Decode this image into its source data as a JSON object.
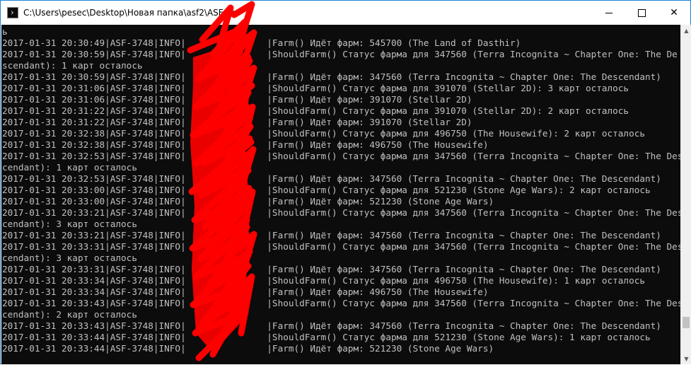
{
  "window": {
    "title": "C:\\Users\\pesec\\Desktop\\Новая папка\\asf2\\ASF.exe",
    "icon_text": "›"
  },
  "controls": {
    "minimize": "minimize-icon",
    "maximize": "maximize-icon",
    "close_glyph": "✕"
  },
  "console": {
    "lines": [
      "ь",
      "2017-01-31 20:30:49|ASF-3748|INFO|               |Farm() Идёт фарм: 545700 (The Land of Dasthir)",
      "2017-01-31 20:30:59|ASF-3748|INFO|               |ShouldFarm() Статус фарма для 347560 (Terra Incognita ~ Chapter One: The De",
      "scendant): 1 карт осталось",
      "2017-01-31 20:30:59|ASF-3748|INFO|               |Farm() Идёт фарм: 347560 (Terra Incognita ~ Chapter One: The Descendant)",
      "2017-01-31 20:31:06|ASF-3748|INFO|               |ShouldFarm() Статус фарма для 391070 (Stellar 2D): 3 карт осталось",
      "2017-01-31 20:31:06|ASF-3748|INFO|               |Farm() Идёт фарм: 391070 (Stellar 2D)",
      "2017-01-31 20:31:22|ASF-3748|INFO|               |ShouldFarm() Статус фарма для 391070 (Stellar 2D): 2 карт осталось",
      "2017-01-31 20:31:22|ASF-3748|INFO|               |Farm() Идёт фарм: 391070 (Stellar 2D)",
      "2017-01-31 20:32:38|ASF-3748|INFO|               |ShouldFarm() Статус фарма для 496750 (The Housewife): 2 карт осталось",
      "2017-01-31 20:32:38|ASF-3748|INFO|               |Farm() Идёт фарм: 496750 (The Housewife)",
      "2017-01-31 20:32:53|ASF-3748|INFO|               |ShouldFarm() Статус фарма для 347560 (Terra Incognita ~ Chapter One: The Desc",
      "cendant): 1 карт осталось",
      "2017-01-31 20:32:53|ASF-3748|INFO|               |Farm() Идёт фарм: 347560 (Terra Incognita ~ Chapter One: The Descendant)",
      "2017-01-31 20:33:00|ASF-3748|INFO|               |ShouldFarm() Статус фарма для 521230 (Stone Age Wars): 2 карт осталось",
      "2017-01-31 20:33:00|ASF-3748|INFO|               |Farm() Идёт фарм: 521230 (Stone Age Wars)",
      "2017-01-31 20:33:21|ASF-3748|INFO|               |ShouldFarm() Статус фарма для 347560 (Terra Incognita ~ Chapter One: The Des",
      "cendant): 3 карт осталось",
      "2017-01-31 20:33:21|ASF-3748|INFO|               |Farm() Идёт фарм: 347560 (Terra Incognita ~ Chapter One: The Descendant)",
      "2017-01-31 20:33:31|ASF-3748|INFO|               |ShouldFarm() Статус фарма для 347560 (Terra Incognita ~ Chapter One: The Des",
      "cendant): 3 карт осталось",
      "2017-01-31 20:33:31|ASF-3748|INFO|               |Farm() Идёт фарм: 347560 (Terra Incognita ~ Chapter One: The Descendant)",
      "2017-01-31 20:33:34|ASF-3748|INFO|               |ShouldFarm() Статус фарма для 496750 (The Housewife): 1 карт осталось",
      "2017-01-31 20:33:34|ASF-3748|INFO|               |Farm() Идёт фарм: 496750 (The Housewife)",
      "2017-01-31 20:33:43|ASF-3748|INFO|               |ShouldFarm() Статус фарма для 347560 (Terra Incognita ~ Chapter One: The Des",
      "cendant): 2 карт осталось",
      "2017-01-31 20:33:43|ASF-3748|INFO|               |Farm() Идёт фарм: 347560 (Terra Incognita ~ Chapter One: The Descendant)",
      "2017-01-31 20:33:44|ASF-3748|INFO|               |ShouldFarm() Статус фарма для 521230 (Stone Age Wars): 1 карт осталось",
      "2017-01-31 20:33:44|ASF-3748|INFO|               |Farm() Идёт фарм: 521230 (Stone Age Wars)"
    ]
  },
  "scrollbar": {
    "up_arrow": "▲",
    "down_arrow": "▼",
    "position_fraction": 0.92
  },
  "colors": {
    "console_bg": "#0c0c0c",
    "console_text": "#c0c0c0",
    "redaction": "#ff0000",
    "window_border": "#1883d7"
  }
}
